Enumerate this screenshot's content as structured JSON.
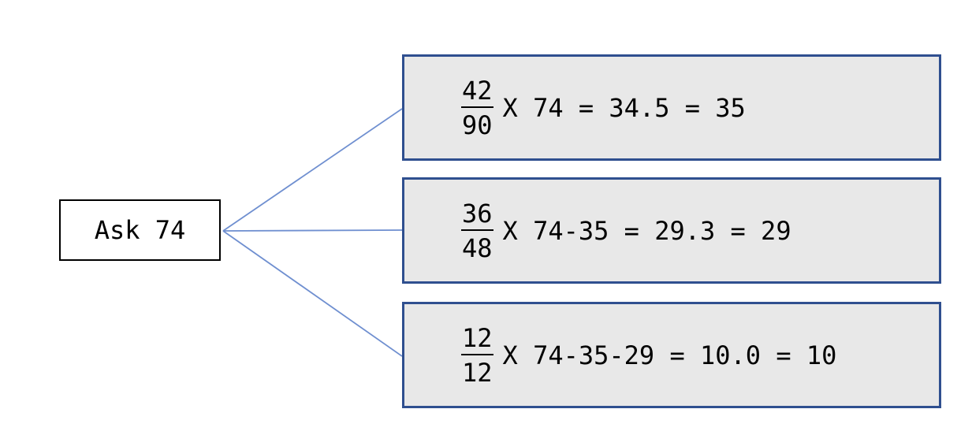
{
  "root": {
    "label": "Ask 74"
  },
  "colors": {
    "connector": "#6f8fd0",
    "box_border": "#2f4f8f",
    "box_fill": "#e8e8e8"
  },
  "calculations": [
    {
      "numerator": "42",
      "denominator": "90",
      "expression": "X 74 = 34.5 = 35"
    },
    {
      "numerator": "36",
      "denominator": "48",
      "expression": "X 74-35 = 29.3 = 29"
    },
    {
      "numerator": "12",
      "denominator": "12",
      "expression": "X 74-35-29 = 10.0 = 10"
    }
  ]
}
